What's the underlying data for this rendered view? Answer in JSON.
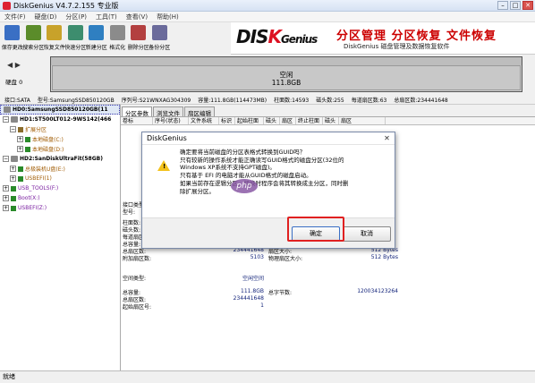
{
  "window": {
    "title": "DiskGenius V4.7.2.155 专业版"
  },
  "menu": [
    "文件(F)",
    "硬盘(D)",
    "分区(P)",
    "工具(T)",
    "查看(V)",
    "帮助(H)"
  ],
  "toolbar": [
    {
      "label": "保存更改",
      "icon": "save-icon",
      "color": "#3a6fc4"
    },
    {
      "label": "搜索分区",
      "icon": "search-partition-icon",
      "color": "#5b8c2a"
    },
    {
      "label": "恢复文件",
      "icon": "recover-file-icon",
      "color": "#c8a22a"
    },
    {
      "label": "快速分区",
      "icon": "quick-partition-icon",
      "color": "#3d8d6e"
    },
    {
      "label": "新建分区",
      "icon": "new-partition-icon",
      "color": "#2f7fc1"
    },
    {
      "label": "格式化",
      "icon": "format-icon",
      "color": "#8b8b8b"
    },
    {
      "label": "删除分区",
      "icon": "delete-partition-icon",
      "color": "#b34040"
    },
    {
      "label": "备份分区",
      "icon": "backup-partition-icon",
      "color": "#6b6b9b"
    }
  ],
  "banner": {
    "logo": "DISKGenius",
    "slogan": "分区管理 分区恢复 文件恢复",
    "sub": "DiskGenius 磁盘管理及数据恢复软件"
  },
  "diskmap": {
    "disk_label": "硬盘 0",
    "partition_name": "空闲",
    "partition_size": "111.8GB"
  },
  "infoline": [
    "接口:SATA",
    "型号:SamsungSSD850120GB",
    "序列号:S21WNXAG304309",
    "容量:111.8GB(114473MB)",
    "柱面数:14593",
    "磁头数:255",
    "每道扇区数:63",
    "总扇区数:234441648"
  ],
  "tree": [
    {
      "text": "HD0:SamsungSSD850120GB(11",
      "level": 0,
      "exp": "",
      "kind": "disk",
      "selected": true
    },
    {
      "text": "HD1:ST500LT012-9WS142(466",
      "level": 0,
      "exp": "−",
      "kind": "disk"
    },
    {
      "text": "扩展分区",
      "level": 1,
      "exp": "−",
      "kind": "ext"
    },
    {
      "text": "本地磁盘(C:)",
      "level": 2,
      "exp": "+",
      "kind": "vol"
    },
    {
      "text": "本地磁盘(D:)",
      "level": 2,
      "exp": "+",
      "kind": "vol"
    },
    {
      "text": "HD2:SanDiskUltraFit(58GB)",
      "level": 0,
      "exp": "−",
      "kind": "disk"
    },
    {
      "text": "总极装机U盘(E:)",
      "level": 1,
      "exp": "+",
      "kind": "vol"
    },
    {
      "text": "USBEFI(1)",
      "level": 1,
      "exp": "+",
      "kind": "vol"
    },
    {
      "text": "USB_TOOLS(F:)",
      "level": 0,
      "exp": "+",
      "kind": "vol"
    },
    {
      "text": "Boot(X:)",
      "level": 0,
      "exp": "+",
      "kind": "vol"
    },
    {
      "text": "USBEFI(Z:)",
      "level": 0,
      "exp": "+",
      "kind": "vol"
    }
  ],
  "tabs": [
    "分区参数",
    "浏览文件",
    "扇区编辑"
  ],
  "columns": [
    "卷标",
    "序号(状态)",
    "文件系统",
    "标识",
    "起始柱面",
    "磁头",
    "扇区",
    "终止柱面",
    "磁头",
    "扇区"
  ],
  "details": {
    "row1": {
      "k": "接口类型:",
      "v": ""
    },
    "row2": {
      "k": "型号:",
      "v": ""
    },
    "cyl": {
      "k": "柱面数:",
      "v": ""
    },
    "heads": {
      "k": "磁头数:",
      "v": ""
    },
    "spt": {
      "k": "每道扇区:",
      "v": ""
    },
    "cap": {
      "k": "总容量:",
      "v": ""
    },
    "total_sectors": {
      "k": "总扇区数:",
      "v": "234441648"
    },
    "extra_sectors": {
      "k": "附加扇区数:",
      "v": "5103"
    },
    "sector_size": {
      "k": "扇区大小:",
      "v": "512 Bytes"
    },
    "phys_sector": {
      "k": "物理扇区大小:",
      "v": "512 Bytes"
    },
    "free_type": {
      "k": "空间类型:",
      "v": "空闲空间"
    },
    "free_cap": {
      "k": "总容量:",
      "v": "111.8GB"
    },
    "free_sectors": {
      "k": "总扇区数:",
      "v": "234441648"
    },
    "start_sector": {
      "k": "起始扇区号:",
      "v": "1"
    },
    "total_bytes": {
      "k": "总字节数:",
      "v": "120034123264"
    }
  },
  "status": "就绪",
  "dialog": {
    "title": "DiskGenius",
    "message": [
      "确定要将当前磁盘的分区表格式转换到GUID吗？",
      "只有较新的操作系统才能正确读写GUID格式的磁盘分区(32位的",
      "Windows XP系统不支持GPT磁盘)。",
      "只有基于 EFI 的电脑才能从GUID格式的磁盘启动。",
      "如果当前存在逻辑分区，转换时程序会将其转换成主分区，同时删",
      "除扩展分区。"
    ],
    "ok": "确定",
    "cancel": "取消"
  },
  "watermark": "php"
}
